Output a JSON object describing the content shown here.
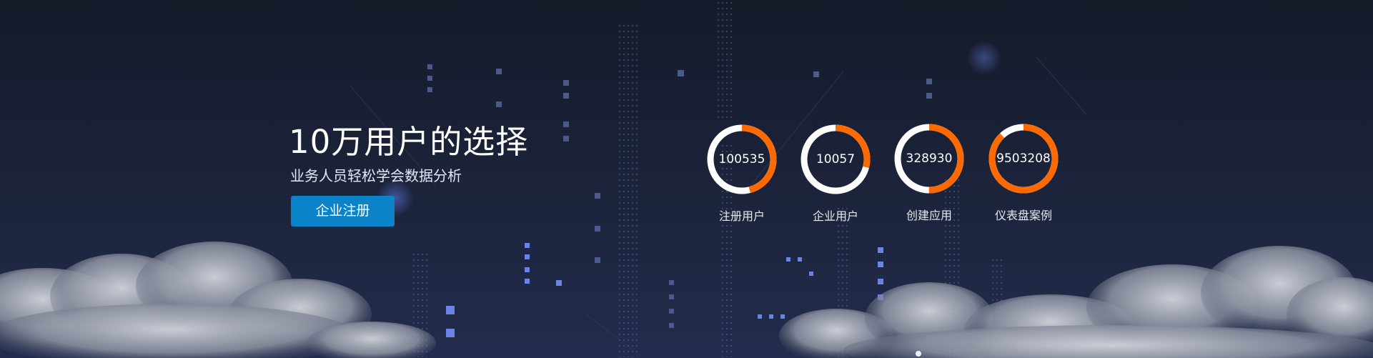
{
  "hero": {
    "title": "10万用户的选择",
    "subtitle": "业务人员轻松学会数据分析",
    "cta_label": "企业注册"
  },
  "stats": [
    {
      "value": "100535",
      "label": "注册用户",
      "progress": 0.46
    },
    {
      "value": "10057",
      "label": "企业用户",
      "progress": 0.29
    },
    {
      "value": "328930",
      "label": "创建应用",
      "progress": 0.5
    },
    {
      "value": "9503208",
      "label": "仪表盘案例",
      "progress": 0.88
    }
  ],
  "colors": {
    "ring_progress": "#ff6a00",
    "ring_track": "#ffffff",
    "cta_background": "#0b83c8"
  }
}
